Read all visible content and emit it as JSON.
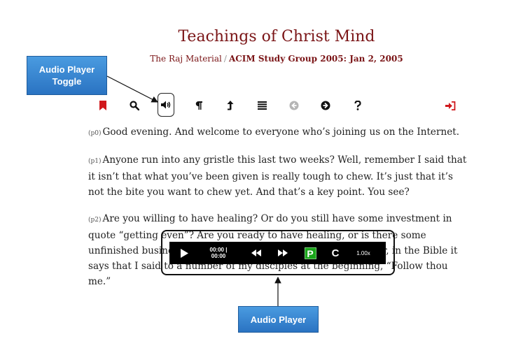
{
  "header": {
    "title": "Teachings of Christ Mind",
    "source": "The Raj Material",
    "separator": "/",
    "section": "ACIM Study Group 2005: Jan 2, 2005"
  },
  "toolbar": {
    "icons": [
      "bookmark-icon",
      "search-icon",
      "speaker-icon",
      "paragraph-icon",
      "up-arrow-icon",
      "list-icon",
      "previous-icon",
      "next-icon",
      "help-icon",
      "sign-in-icon"
    ],
    "colors": {
      "bookmark": "#d0181c",
      "disabled": "#b5b5b5",
      "default": "#111111",
      "signin": "#d0181c"
    }
  },
  "content": {
    "paragraphs": [
      {
        "num": "(p0)",
        "text": "Good evening. And welcome to everyone who’s joining us on the Internet."
      },
      {
        "num": "(p1)",
        "text": "Anyone run into any gristle this last two weeks? Well, remember I said that it isn’t that what you’ve been given is really tough to chew. It’s just that it’s not the bite you want to chew yet. And that’s a key point. You see?"
      },
      {
        "num": "(p2)",
        "text": "Are you willing to have healing? Or do you still have some investment in quote “getting even”? Are you ready to have healing, or is there some unfinished business you want to take care of first? Remember, in the Bible it says that I said to a number of my disciples at the beginning, “Follow thou me.”"
      }
    ]
  },
  "player": {
    "time_current": "00:00",
    "time_separator": "|",
    "time_total": "00:00",
    "p_label": "P",
    "c_label": "C",
    "speed": "1.00x"
  },
  "callouts": {
    "toggle": "Audio Player Toggle",
    "player": "Audio Player"
  }
}
